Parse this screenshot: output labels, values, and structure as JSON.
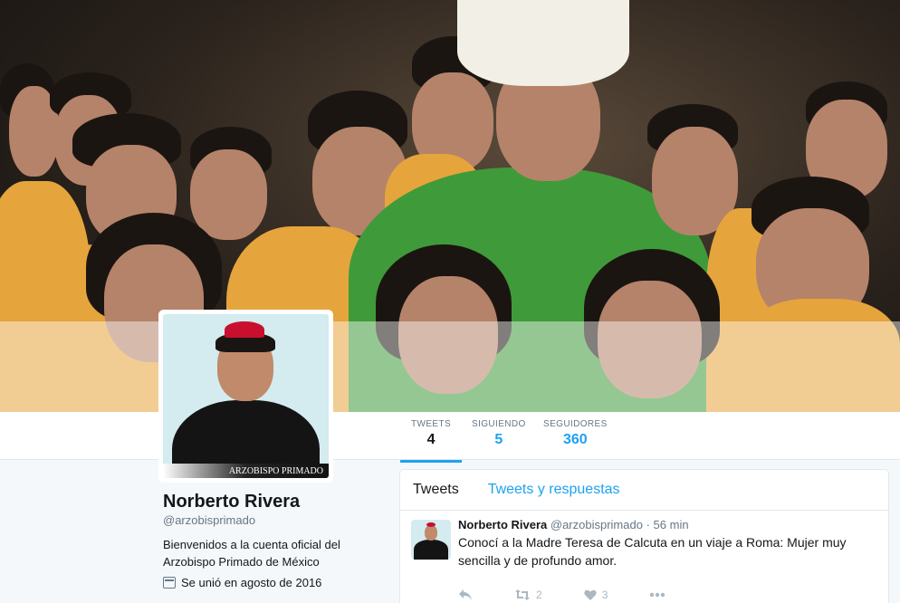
{
  "profile": {
    "name": "Norberto Rivera",
    "handle": "@arzobisprimado",
    "bio": "Bienvenidos a la cuenta oficial del Arzobispo Primado de México",
    "joined": "Se unió en agosto de 2016",
    "avatar_caption": "ARZOBISPO PRIMADO"
  },
  "stats": [
    {
      "label": "TWEETS",
      "value": "4"
    },
    {
      "label": "SIGUIENDO",
      "value": "5"
    },
    {
      "label": "SEGUIDORES",
      "value": "360"
    }
  ],
  "timeline": {
    "tabs": [
      "Tweets",
      "Tweets y respuestas"
    ],
    "tweet": {
      "name": "Norberto Rivera",
      "handle": "@arzobisprimado",
      "separator": "·",
      "time": "56 min",
      "text": "Conocí a la Madre Teresa de Calcuta en un viaje a Roma: Mujer muy sencilla y de profundo amor.",
      "retweets": "2",
      "likes": "3"
    }
  },
  "colors": {
    "accent": "#1da1f2",
    "text": "#14171a",
    "muted": "#657786"
  }
}
